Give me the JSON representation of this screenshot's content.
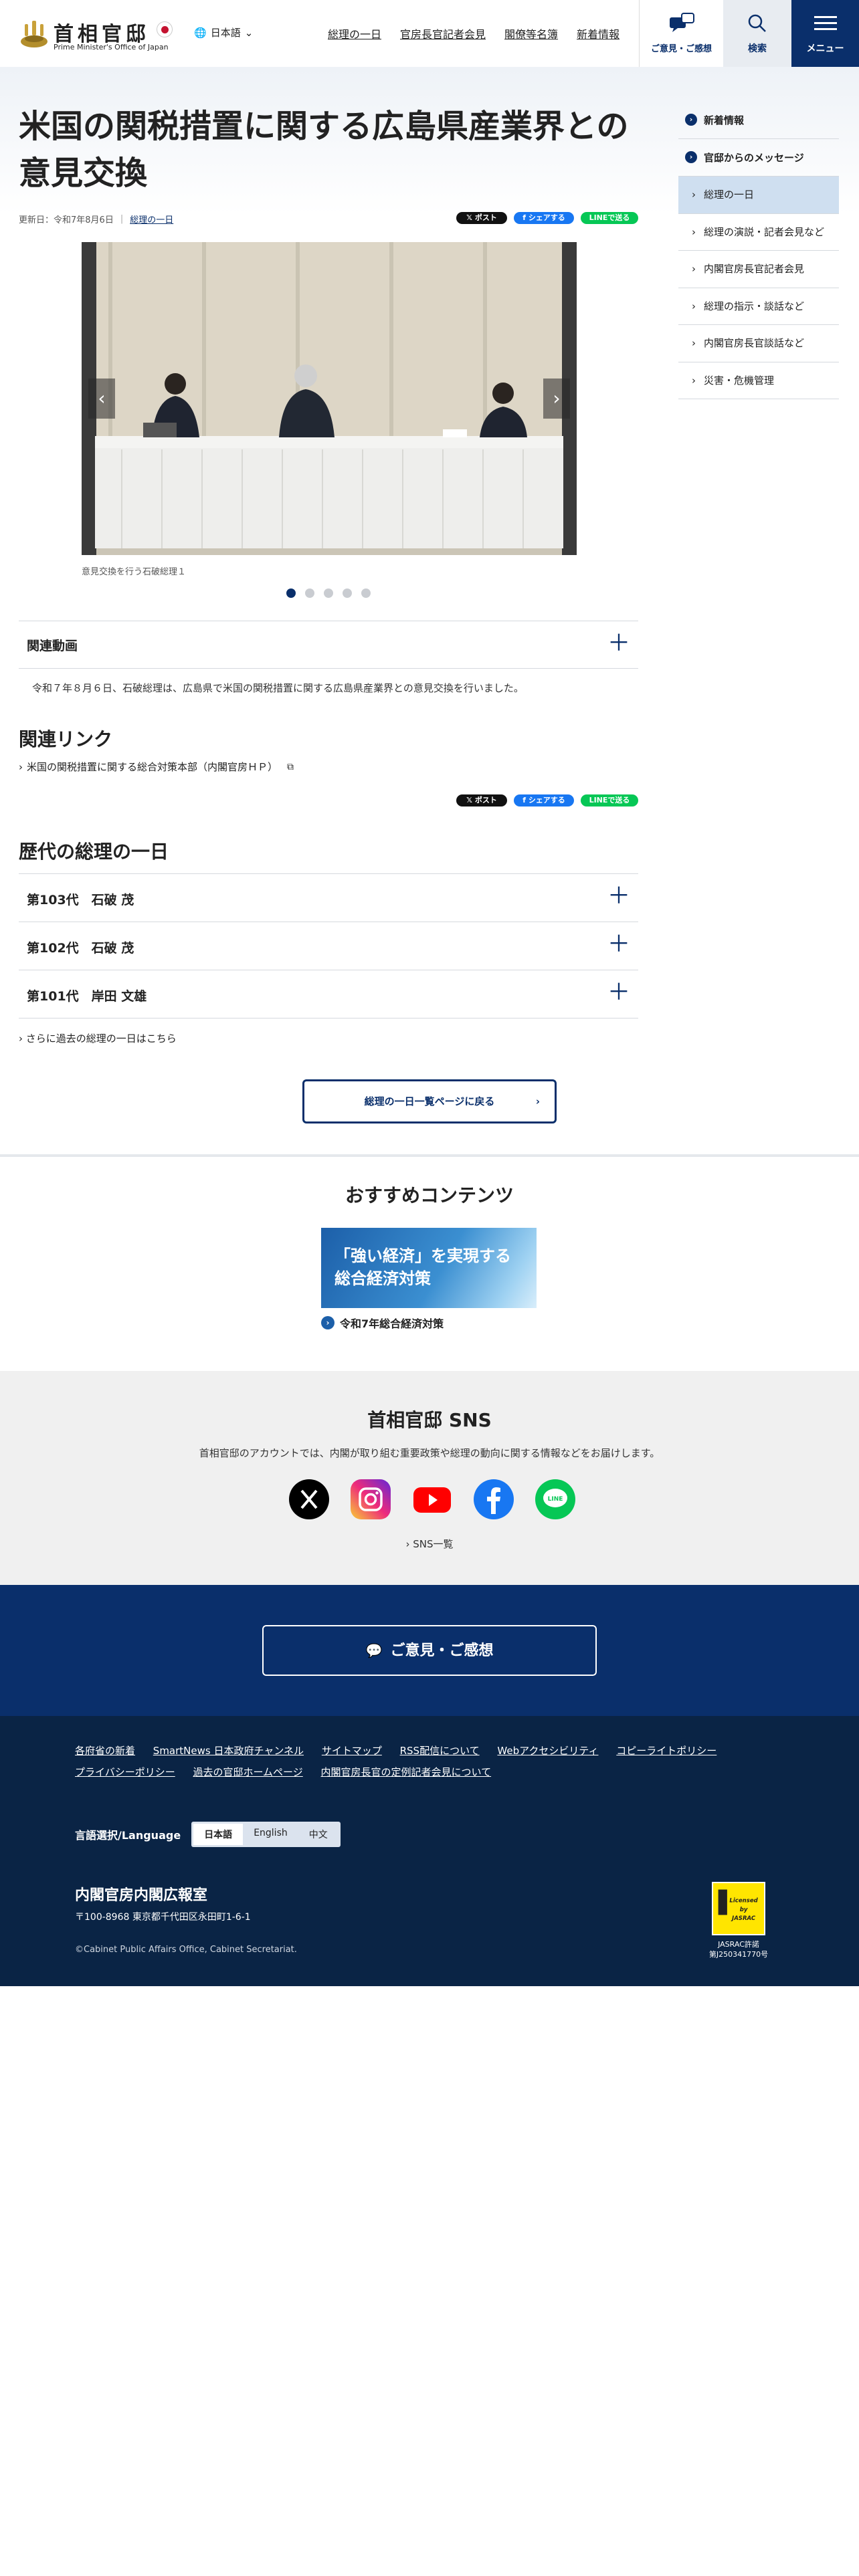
{
  "header": {
    "logo_kanji": "首相官邸",
    "logo_en": "Prime Minister's Office of Japan",
    "lang": "日本語",
    "nav": [
      "総理の一日",
      "官房長官記者会見",
      "閣僚等名簿",
      "新着情報"
    ],
    "opinion": "ご意見・ご感想",
    "search": "検索",
    "menu": "メニュー"
  },
  "article": {
    "title": "米国の関税措置に関する広島県産業界との意見交換",
    "updated": "更新日：令和7年8月6日",
    "category": "総理の一日",
    "caption": "意見交換を行う石破総理１",
    "share": {
      "x": "ポスト",
      "facebook": "シェアする",
      "line": "LINEで送る"
    },
    "video_heading": "関連動画",
    "video_desc": "令和７年８月６日、石破総理は、広島県で米国の関税措置に関する広島県産業界との意見交換を行いました。",
    "links_heading": "関連リンク",
    "link": "米国の関税措置に関する総合対策本部（内閣官房ＨＰ）",
    "history_heading": "歴代の総理の一日",
    "history": [
      "第103代　石破 茂",
      "第102代　石破 茂",
      "第101代　岸田 文雄"
    ],
    "more_past": "さらに過去の総理の一日はこちら",
    "back": "総理の一日一覧ページに戻る"
  },
  "sidebar": {
    "top1": "新着情報",
    "top2": "官邸からのメッセージ",
    "items": [
      "総理の一日",
      "総理の演説・記者会見など",
      "内閣官房長官記者会見",
      "総理の指示・談話など",
      "内閣官房長官談話など",
      "災害・危機管理"
    ]
  },
  "recommend": {
    "title": "おすすめコンテンツ",
    "card": "「強い経済」を実現する\n総合経済対策",
    "link": "令和7年総合経済対策"
  },
  "sns": {
    "title": "首相官邸 SNS",
    "desc": "首相官邸のアカウントでは、内閣が取り組む重要政策や総理の動向に関する情報などをお届けします。",
    "list": "SNS一覧",
    "line_label": "LINE"
  },
  "opinion_band": "ご意見・ご感想",
  "footer": {
    "links": [
      "各府省の新着",
      "SmartNews 日本政府チャンネル",
      "サイトマップ",
      "RSS配信について",
      "Webアクセシビリティ",
      "コピーライトポリシー",
      "プライバシーポリシー",
      "過去の官邸ホームページ",
      "内閣官房長官の定例記者会見について"
    ],
    "lang_label": "言語選択/Language",
    "langs": [
      "日本語",
      "English",
      "中文"
    ],
    "org": "内閣官房内閣広報室",
    "address": "〒100-8968 東京都千代田区永田町1-6-1",
    "copyright": "©Cabinet Public Affairs Office, Cabinet Secretariat.",
    "jasrac": "JASRAC許諾\n第J250341770号"
  },
  "colors": {
    "navy": "#0a2f6b",
    "footer": "#0a2445",
    "active": "#cfdff0"
  }
}
